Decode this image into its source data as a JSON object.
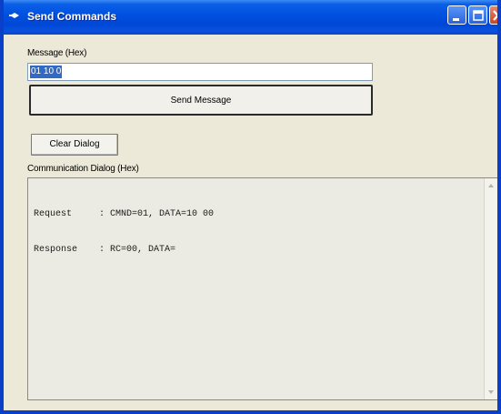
{
  "window": {
    "title": "Send Commands"
  },
  "message": {
    "label": "Message (Hex)",
    "value": "01 10 0"
  },
  "buttons": {
    "send_label": "Send Message",
    "clear_label": "Clear Dialog"
  },
  "dialog": {
    "label": "Communication Dialog (Hex)",
    "lines": [
      "Request     : CMND=01, DATA=10 00",
      "Response    : RC=00, DATA="
    ]
  },
  "icons": {
    "app": "app-icon",
    "minimize": "minimize-icon",
    "maximize": "maximize-icon",
    "close": "close-icon",
    "scroll_up": "arrow-up-icon",
    "scroll_down": "arrow-down-icon"
  },
  "colors": {
    "titlebar": "#0050e0",
    "selection": "#316ac5",
    "window_face": "#ece9d8"
  }
}
